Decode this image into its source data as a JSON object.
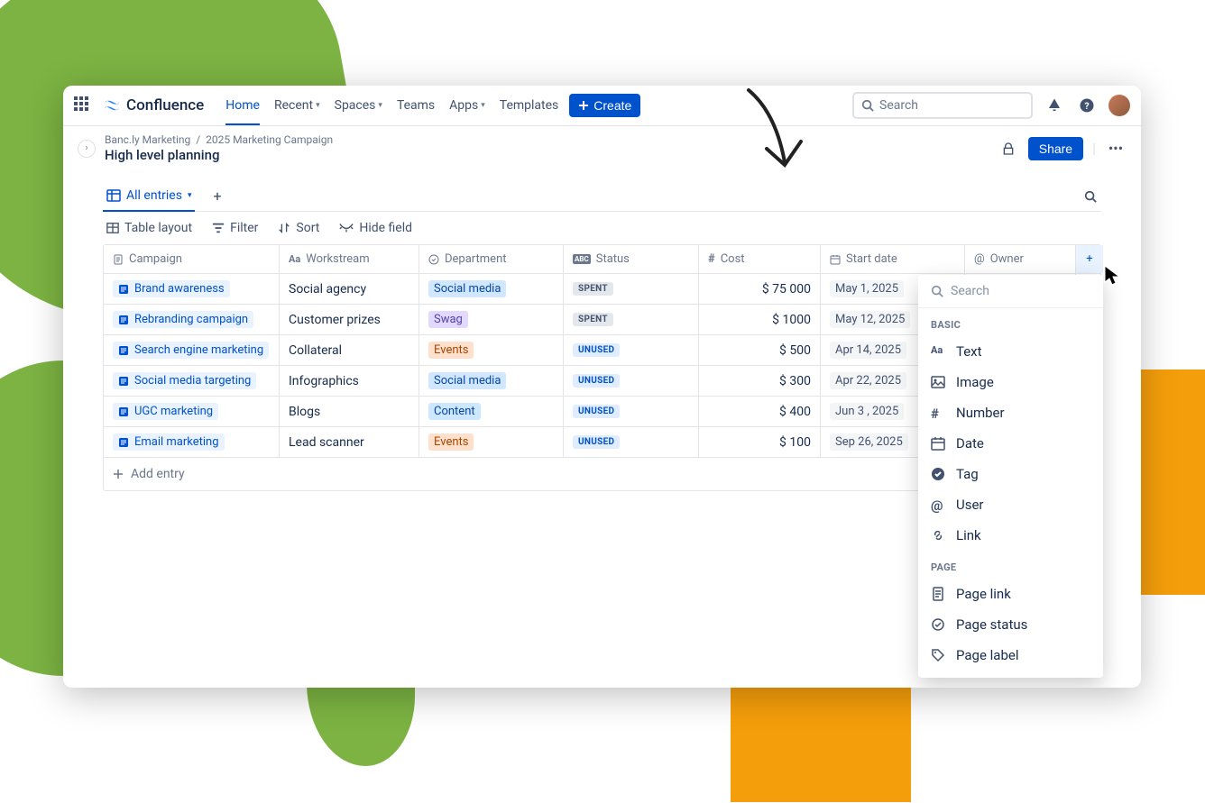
{
  "nav": {
    "logo": "Confluence",
    "links": [
      "Home",
      "Recent",
      "Spaces",
      "Teams",
      "Apps",
      "Templates"
    ],
    "create": "Create",
    "search_placeholder": "Search"
  },
  "breadcrumb": {
    "space": "Banc.ly Marketing",
    "parent": "2025 Marketing Campaign"
  },
  "page_title": "High level planning",
  "share_label": "Share",
  "tabs": {
    "all_entries": "All entries"
  },
  "toolbar": {
    "layout": "Table layout",
    "filter": "Filter",
    "sort": "Sort",
    "hide": "Hide field"
  },
  "columns": {
    "campaign": "Campaign",
    "workstream": "Workstream",
    "department": "Department",
    "status": "Status",
    "cost": "Cost",
    "start_date": "Start date",
    "owner": "Owner"
  },
  "rows": [
    {
      "campaign": "Brand awareness",
      "workstream": "Social agency",
      "department": "Social media",
      "dept_class": "dept-social",
      "status": "SPENT",
      "status_class": "status-spent",
      "cost": "$  75 000",
      "date": "May 1, 2025"
    },
    {
      "campaign": "Rebranding campaign",
      "workstream": "Customer prizes",
      "department": "Swag",
      "dept_class": "dept-swag",
      "status": "SPENT",
      "status_class": "status-spent",
      "cost": "$ 1000",
      "date": "May 12, 2025"
    },
    {
      "campaign": "Search engine marketing",
      "workstream": "Collateral",
      "department": "Events",
      "dept_class": "dept-events",
      "status": "UNUSED",
      "status_class": "status-unused",
      "cost": "$ 500",
      "date": "Apr 14, 2025"
    },
    {
      "campaign": "Social media targeting",
      "workstream": "Infographics",
      "department": "Social media",
      "dept_class": "dept-social",
      "status": "UNUSED",
      "status_class": "status-unused",
      "cost": "$ 300",
      "date": "Apr 22, 2025"
    },
    {
      "campaign": "UGC marketing",
      "workstream": "Blogs",
      "department": "Content",
      "dept_class": "dept-content",
      "status": "UNUSED",
      "status_class": "status-unused",
      "cost": "$  400",
      "date": "Jun 3 , 2025"
    },
    {
      "campaign": "Email marketing",
      "workstream": "Lead scanner",
      "department": "Events",
      "dept_class": "dept-events",
      "status": "UNUSED",
      "status_class": "status-unused",
      "cost": "$ 100",
      "date": "Sep 26, 2025"
    }
  ],
  "add_entry": "Add entry",
  "dropdown": {
    "search_placeholder": "Search",
    "section_basic": "BASIC",
    "section_page": "PAGE",
    "basic": [
      "Text",
      "Image",
      "Number",
      "Date",
      "Tag",
      "User",
      "Link"
    ],
    "page": [
      "Page link",
      "Page status",
      "Page label"
    ]
  }
}
